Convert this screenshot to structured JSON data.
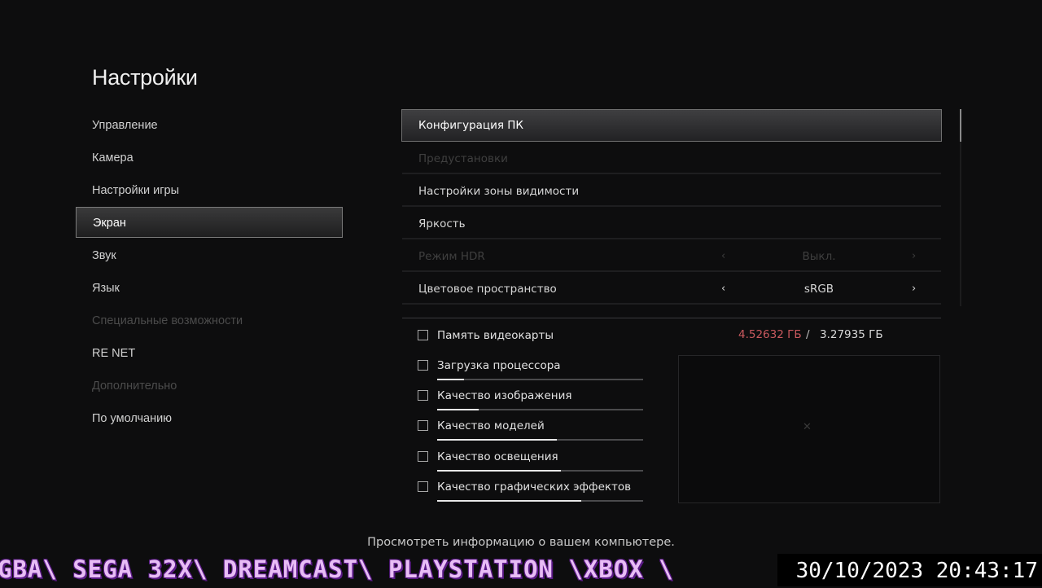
{
  "page_title": "Настройки",
  "categories": [
    {
      "label": "Управление",
      "state": "normal"
    },
    {
      "label": "Камера",
      "state": "normal"
    },
    {
      "label": "Настройки игры",
      "state": "normal"
    },
    {
      "label": "Экран",
      "state": "selected"
    },
    {
      "label": "Звук",
      "state": "normal"
    },
    {
      "label": "Язык",
      "state": "normal"
    },
    {
      "label": "Специальные возможности",
      "state": "disabled"
    },
    {
      "label": "RE NET",
      "state": "normal"
    },
    {
      "label": "Дополнительно",
      "state": "disabled"
    },
    {
      "label": "По умолчанию",
      "state": "normal"
    }
  ],
  "options": [
    {
      "label": "Конфигурация ПК",
      "state": "selected"
    },
    {
      "label": "Предустановки",
      "state": "disabled"
    },
    {
      "label": "Настройки зоны видимости",
      "state": "normal"
    },
    {
      "label": "Яркость",
      "state": "normal"
    },
    {
      "label": "Режим HDR",
      "state": "disabled",
      "value": "Выкл."
    },
    {
      "label": "Цветовое пространство",
      "state": "normal",
      "value": "sRGB"
    }
  ],
  "arrows": {
    "left": "‹",
    "right": "›"
  },
  "metrics": [
    {
      "label": "Память видеокарты",
      "checked": false
    },
    {
      "label": "Загрузка процессора",
      "checked": false,
      "level": 0.13
    },
    {
      "label": "Качество изображения",
      "checked": false,
      "level": 0.2
    },
    {
      "label": "Качество моделей",
      "checked": false,
      "level": 0.58
    },
    {
      "label": "Качество освещения",
      "checked": false,
      "level": 0.6
    },
    {
      "label": "Качество графических эффектов",
      "checked": false,
      "level": 0.7
    }
  ],
  "vram": {
    "used": "4.52632 ГБ",
    "separator": "/",
    "total": "3.27935 ГБ"
  },
  "scroll_position": 0,
  "preview_icon": "✕",
  "hint_text": "Просмотреть информацию о вашем компьютере.",
  "ticker_text": "GBA\\ SEGA 32X\\ DREAMCAST\\ PLAYSTATION \\XBOX \\",
  "clock_text": "30/10/2023 20:43:17",
  "colors": {
    "accent_red": "#c9595e",
    "ticker": "#e8bcf5",
    "ticker_outline": "#5a1a86"
  }
}
